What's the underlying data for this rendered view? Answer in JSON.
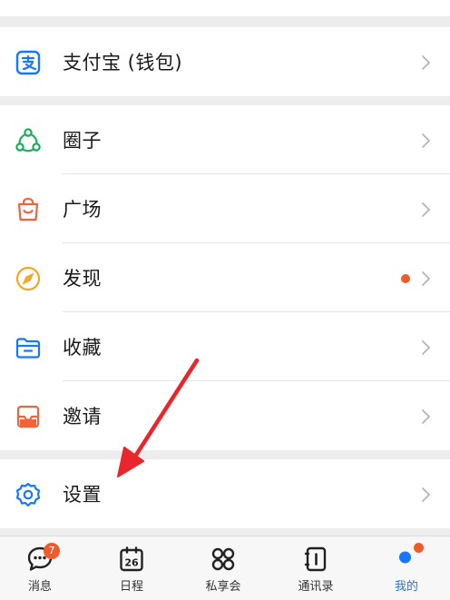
{
  "menu": {
    "alipay": "支付宝 (钱包)",
    "moments": "圈子",
    "square": "广场",
    "discover": "发现",
    "favorites": "收藏",
    "invite": "邀请",
    "settings": "设置"
  },
  "tabbar": {
    "messages": "消息",
    "messages_badge": "7",
    "schedule": "日程",
    "schedule_day": "26",
    "club": "私享会",
    "contacts": "通讯录",
    "me": "我的"
  },
  "colors": {
    "alipay_icon": "#1677ff",
    "moments_icon": "#1aad5c",
    "square_icon": "#f0643c",
    "discover_icon": "#f5a623",
    "favorites_icon": "#1677ff",
    "invite_icon": "#f0643c",
    "settings_icon": "#1677ff",
    "badge": "#f25a29",
    "active_tab": "#1677ff",
    "annotation_arrow": "#e8262b"
  },
  "icons": {
    "alipay": "alipay-icon",
    "moments": "circle-nodes-icon",
    "square": "shopping-bag-icon",
    "discover": "compass-icon",
    "favorites": "folder-icon",
    "invite": "envelope-icon",
    "settings": "gear-icon"
  }
}
